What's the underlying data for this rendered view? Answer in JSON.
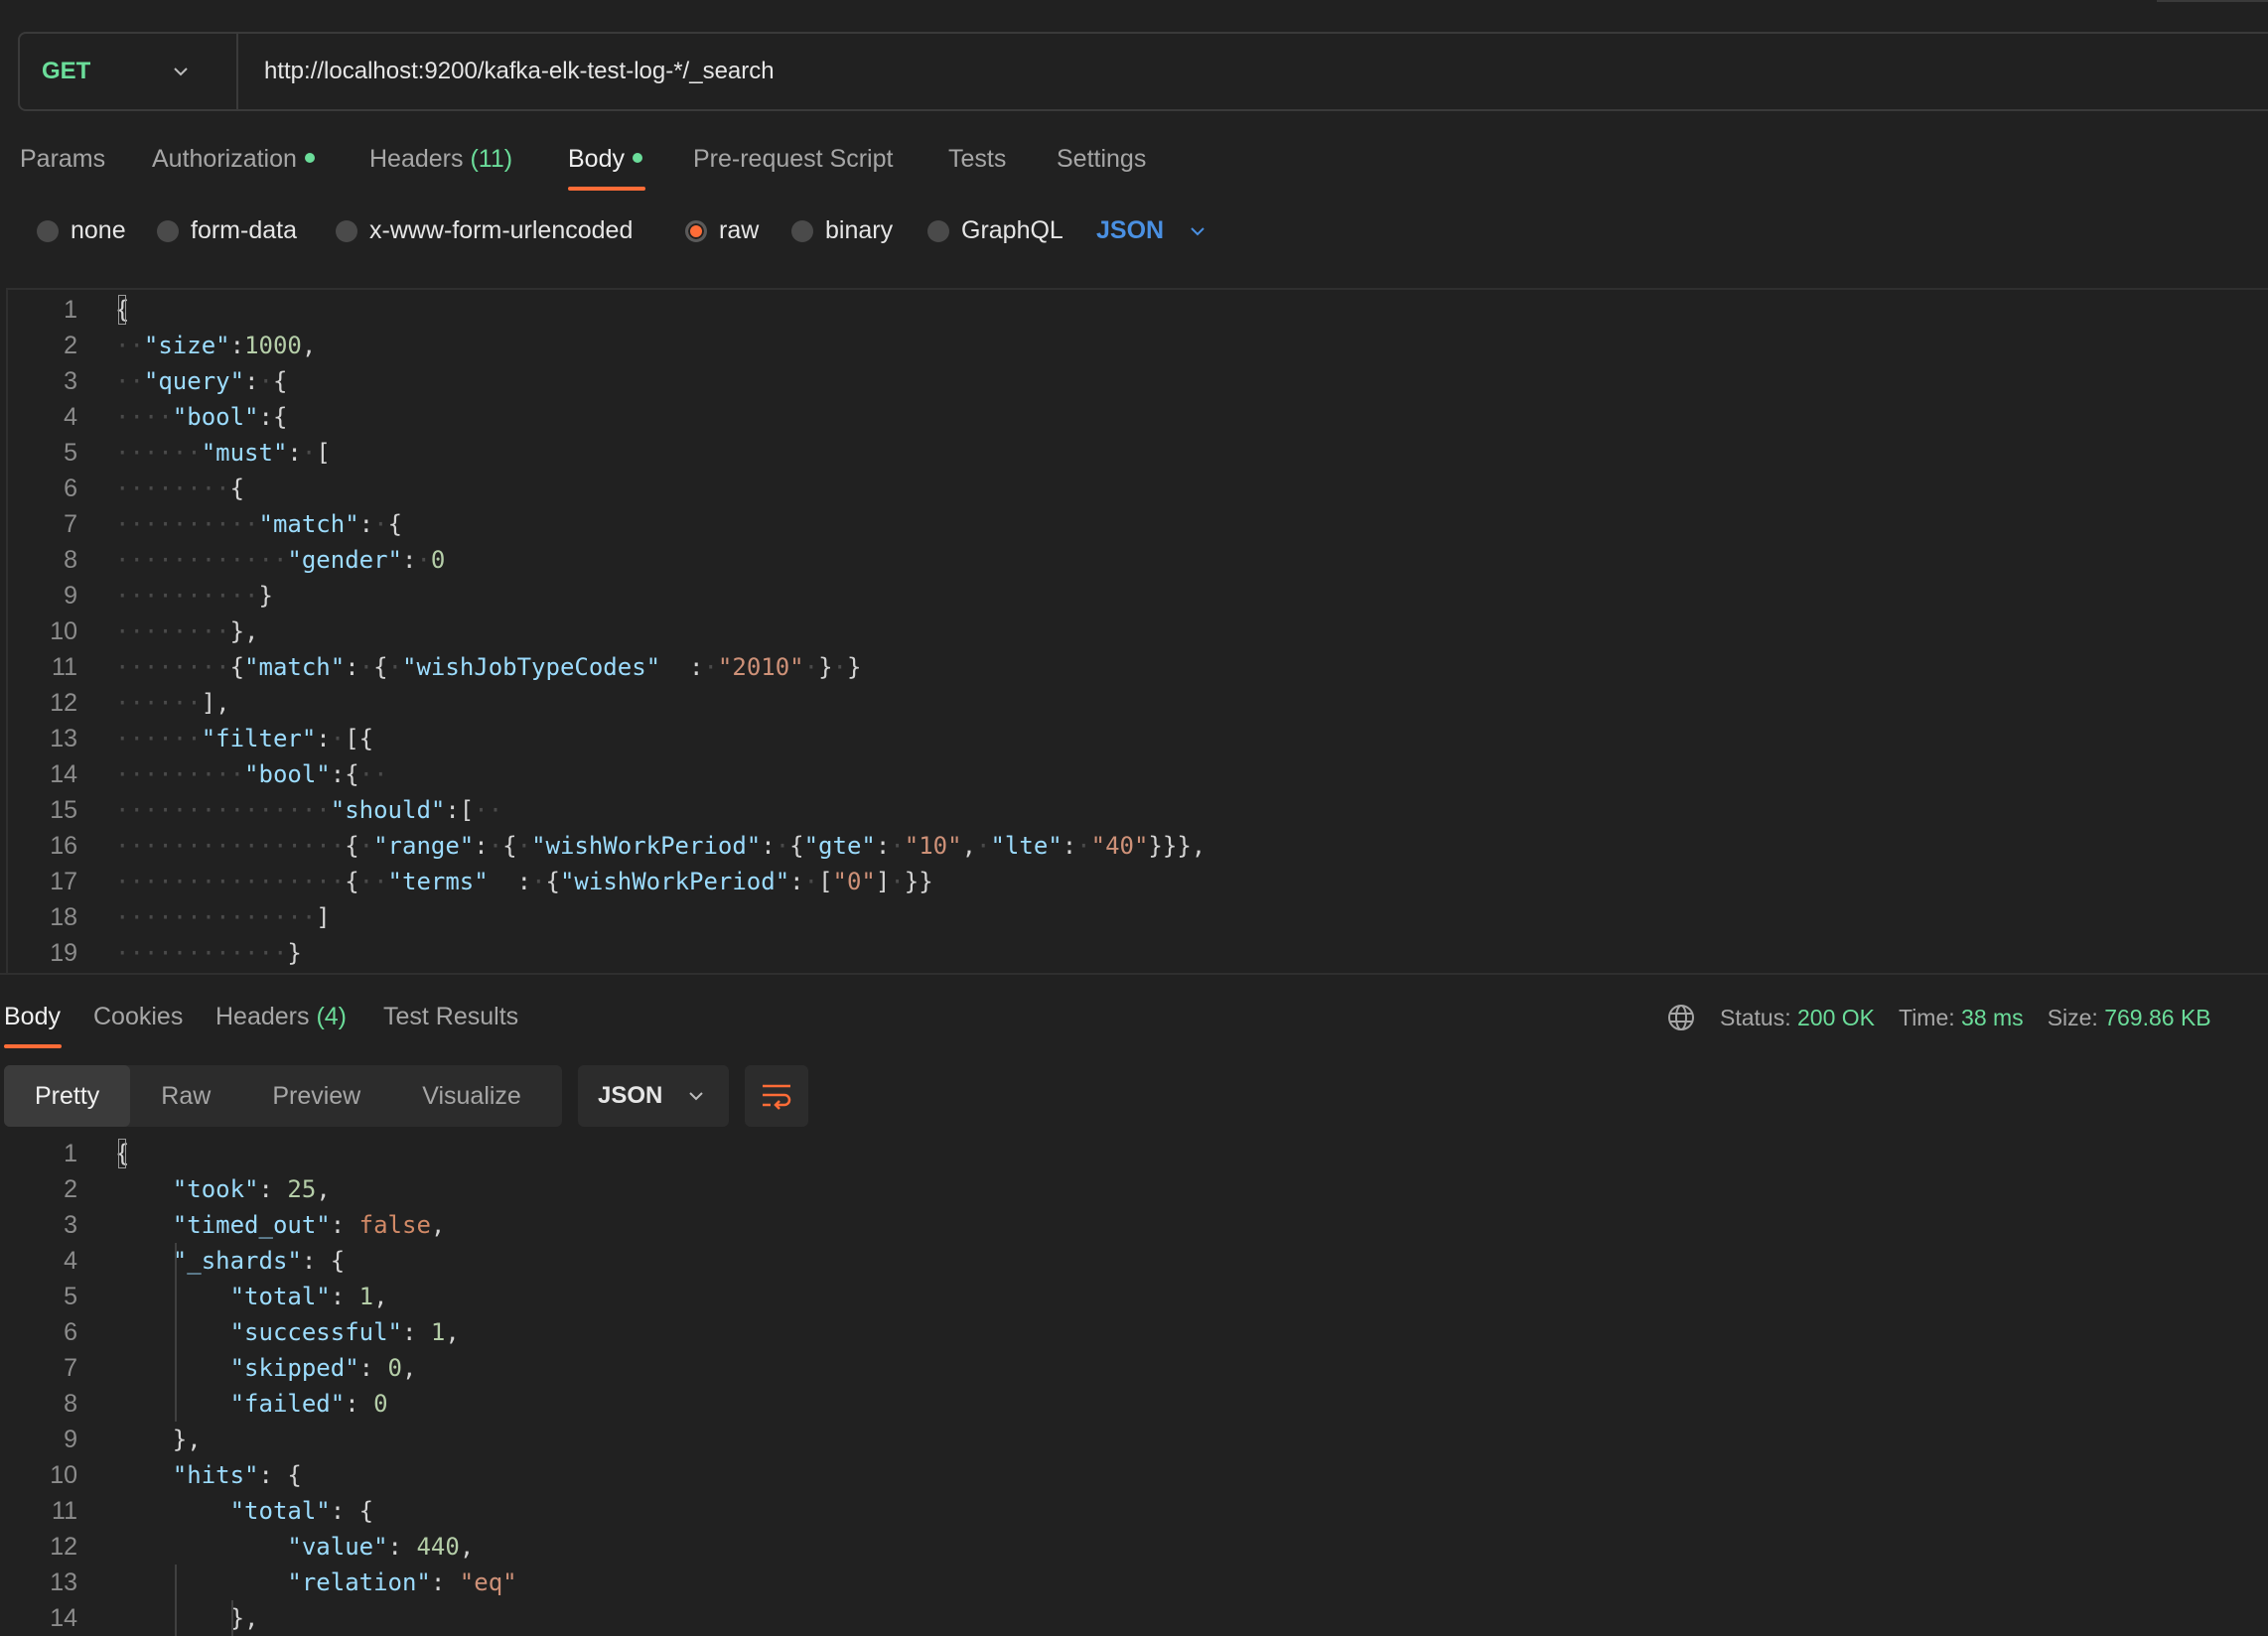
{
  "request": {
    "method": "GET",
    "url": "http://localhost:9200/kafka-elk-test-log-*/_search"
  },
  "request_tabs": {
    "params": "Params",
    "authorization": "Authorization",
    "headers": "Headers",
    "headers_count": "(11)",
    "body": "Body",
    "pre_request": "Pre-request Script",
    "tests": "Tests",
    "settings": "Settings"
  },
  "body_types": {
    "none": "none",
    "form_data": "form-data",
    "urlencoded": "x-www-form-urlencoded",
    "raw": "raw",
    "binary": "binary",
    "graphql": "GraphQL",
    "language": "JSON",
    "selected": "raw"
  },
  "request_body_lines": [
    "{",
    "  \"size\":1000,",
    "  \"query\": {",
    "    \"bool\":{",
    "      \"must\": [",
    "        {",
    "          \"match\": {",
    "            \"gender\": 0",
    "          }",
    "        },",
    "        {\"match\": { \"wishJobTypeCodes\"  : \"2010\" } }",
    "      ],",
    "      \"filter\": [{",
    "         \"bool\":{  ",
    "               \"should\":[  ",
    "                { \"range\": { \"wishWorkPeriod\": {\"gte\": \"10\", \"lte\": \"40\"}}},",
    "                {  \"terms\"  : {\"wishWorkPeriod\": [\"0\"] }}",
    "              ]",
    "            }"
  ],
  "response_tabs": {
    "body": "Body",
    "cookies": "Cookies",
    "headers": "Headers",
    "headers_count": "(4)",
    "test_results": "Test Results"
  },
  "response_status": {
    "status_label": "Status:",
    "status_value": "200 OK",
    "time_label": "Time:",
    "time_value": "38 ms",
    "size_label": "Size:",
    "size_value": "769.86 KB"
  },
  "view_modes": {
    "pretty": "Pretty",
    "raw": "Raw",
    "preview": "Preview",
    "visualize": "Visualize",
    "format": "JSON"
  },
  "response_body_lines": [
    "{",
    "    \"took\": 25,",
    "    \"timed_out\": false,",
    "    \"_shards\": {",
    "        \"total\": 1,",
    "        \"successful\": 1,",
    "        \"skipped\": 0,",
    "        \"failed\": 0",
    "    },",
    "    \"hits\": {",
    "        \"total\": {",
    "            \"value\": 440,",
    "            \"relation\": \"eq\"",
    "        },"
  ],
  "colors": {
    "accent": "#ff6c37",
    "success": "#6bdd9a",
    "language": "#4a90e2"
  }
}
